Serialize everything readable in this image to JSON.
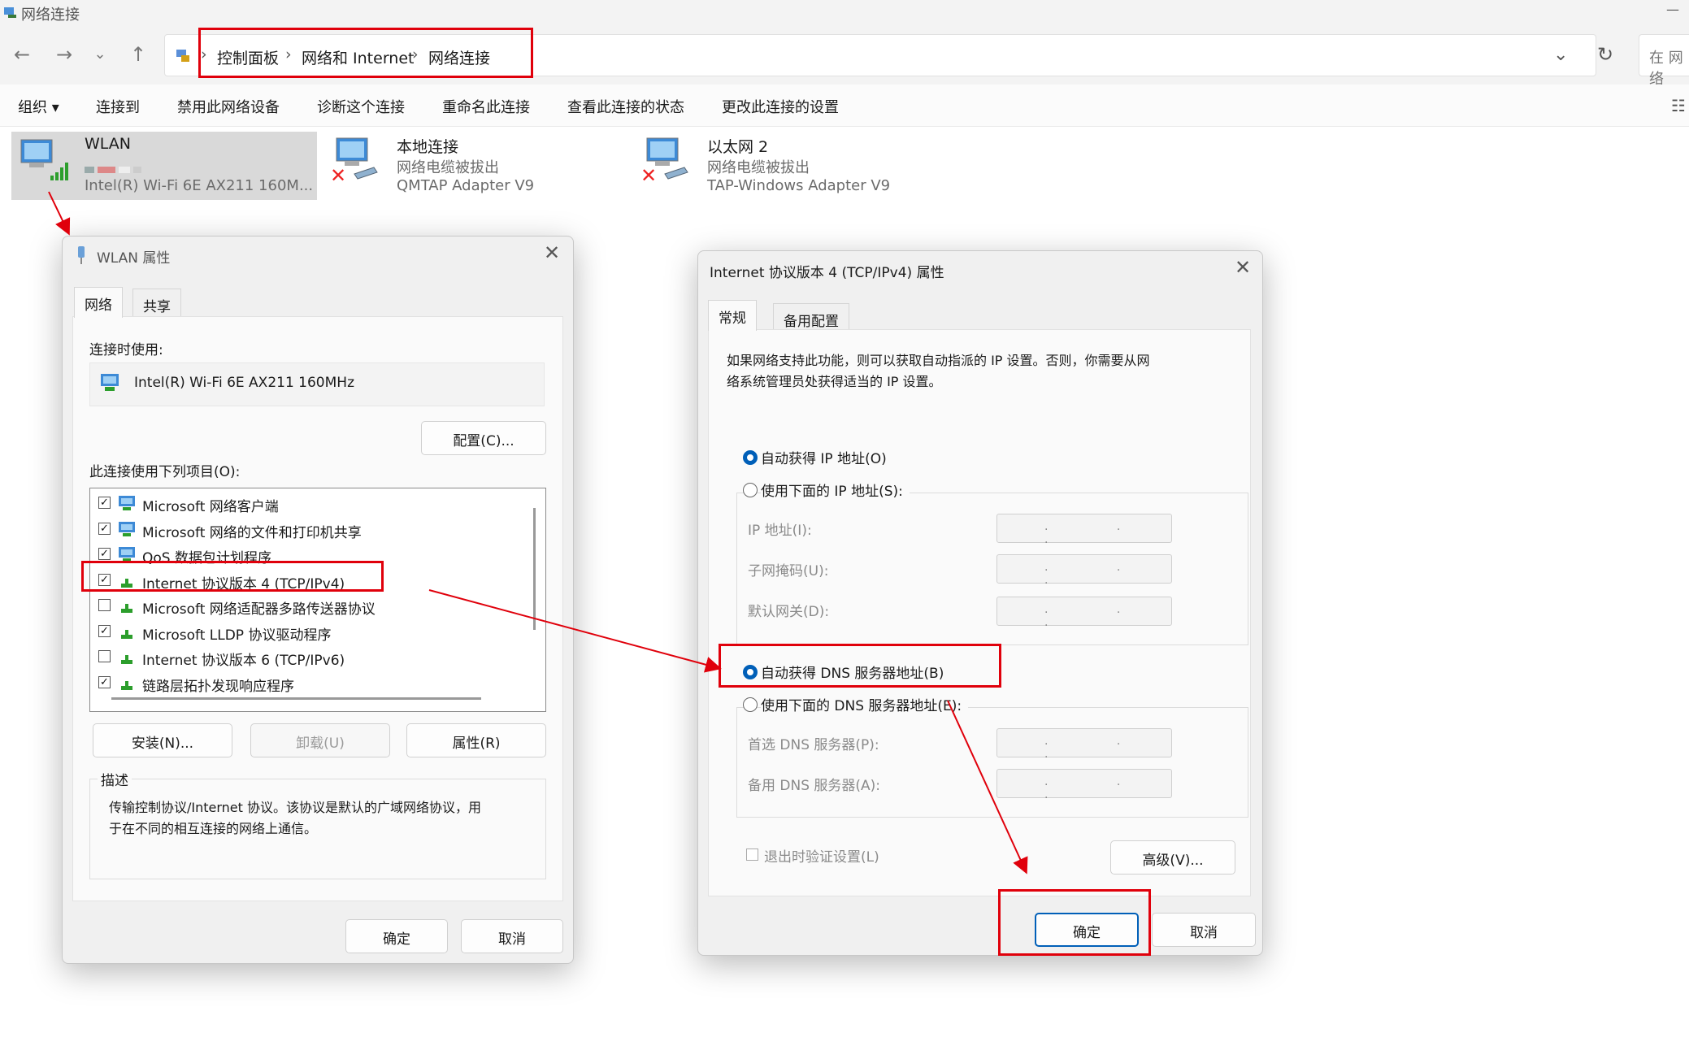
{
  "window": {
    "title": "网络连接"
  },
  "nav": {
    "breadcrumb": [
      "控制面板",
      "网络和 Internet",
      "网络连接"
    ],
    "search_placeholder": "在 网络"
  },
  "commands": [
    "组织 ▾",
    "连接到",
    "禁用此网络设备",
    "诊断这个连接",
    "重命名此连接",
    "查看此连接的状态",
    "更改此连接的设置"
  ],
  "connections": [
    {
      "name": "WLAN",
      "status": "",
      "device": "Intel(R) Wi-Fi 6E AX211 160M..."
    },
    {
      "name": "本地连接",
      "status": "网络电缆被拔出",
      "device": "QMTAP Adapter V9"
    },
    {
      "name": "以太网 2",
      "status": "网络电缆被拔出",
      "device": "TAP-Windows Adapter V9"
    }
  ],
  "wlan_dialog": {
    "title": "WLAN 属性",
    "tabs": [
      "网络",
      "共享"
    ],
    "connect_using_label": "连接时使用:",
    "adapter": "Intel(R) Wi-Fi 6E AX211 160MHz",
    "configure_btn": "配置(C)...",
    "items_label": "此连接使用下列项目(O):",
    "items": [
      {
        "checked": true,
        "label": "Microsoft 网络客户端"
      },
      {
        "checked": true,
        "label": "Microsoft 网络的文件和打印机共享"
      },
      {
        "checked": true,
        "label": "QoS 数据包计划程序"
      },
      {
        "checked": true,
        "label": "Internet 协议版本 4 (TCP/IPv4)"
      },
      {
        "checked": false,
        "label": "Microsoft 网络适配器多路传送器协议"
      },
      {
        "checked": true,
        "label": "Microsoft LLDP 协议驱动程序"
      },
      {
        "checked": false,
        "label": "Internet 协议版本 6 (TCP/IPv6)"
      },
      {
        "checked": true,
        "label": "链路层拓扑发现响应程序"
      }
    ],
    "install_btn": "安装(N)...",
    "uninstall_btn": "卸载(U)",
    "properties_btn": "属性(R)",
    "desc_label": "描述",
    "desc_text_1": "传输控制协议/Internet 协议。该协议是默认的广域网络协议，用",
    "desc_text_2": "于在不同的相互连接的网络上通信。",
    "ok_btn": "确定",
    "cancel_btn": "取消"
  },
  "ipv4_dialog": {
    "title": "Internet 协议版本 4 (TCP/IPv4) 属性",
    "tabs": [
      "常规",
      "备用配置"
    ],
    "intro_1": "如果网络支持此功能，则可以获取自动指派的 IP 设置。否则，你需要从网",
    "intro_2": "络系统管理员处获得适当的 IP 设置。",
    "auto_ip": "自动获得 IP 地址(O)",
    "manual_ip": "使用下面的 IP 地址(S):",
    "ip_label": "IP 地址(I):",
    "mask_label": "子网掩码(U):",
    "gateway_label": "默认网关(D):",
    "auto_dns": "自动获得 DNS 服务器地址(B)",
    "manual_dns": "使用下面的 DNS 服务器地址(E):",
    "preferred_dns_label": "首选 DNS 服务器(P):",
    "alternate_dns_label": "备用 DNS 服务器(A):",
    "ip_placeholder": ". . .",
    "validate_label": "退出时验证设置(L)",
    "advanced_btn": "高级(V)...",
    "ok_btn": "确定",
    "cancel_btn": "取消"
  },
  "colors": {
    "annotation_red": "#e0000b",
    "accent": "#005fb8"
  }
}
